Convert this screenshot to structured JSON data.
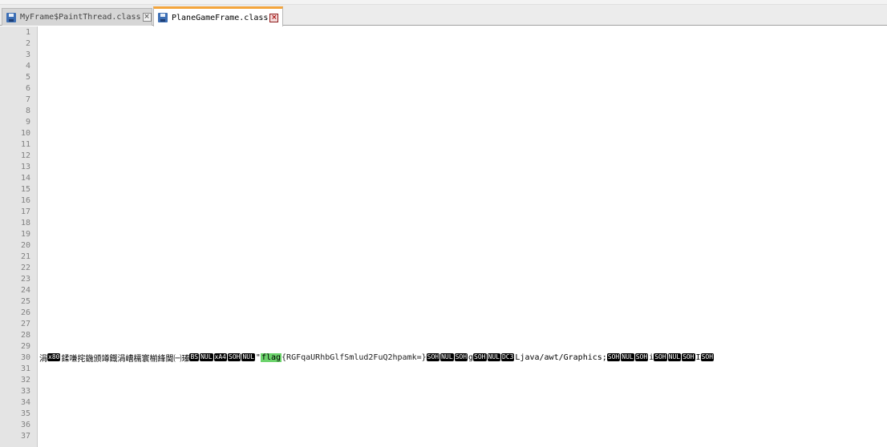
{
  "tabs": [
    {
      "label": "MyFrame$PaintThread.class",
      "active": false
    },
    {
      "label": "PlaneGameFrame.class",
      "active": true
    }
  ],
  "line_numbers": [
    "1",
    "2",
    "3",
    "4",
    "5",
    "6",
    "7",
    "8",
    "9",
    "10",
    "11",
    "12",
    "13",
    "14",
    "15",
    "16",
    "17",
    "18",
    "19",
    "20",
    "21",
    "22",
    "23",
    "24",
    "25",
    "26",
    "27",
    "28",
    "29",
    "30",
    "31",
    "32",
    "33",
    "34",
    "35",
    "36",
    "37"
  ],
  "line30": {
    "seg_1": "涓",
    "cc_1": "x80",
    "seg_2": "鍒嗛挓鍦颁竴鐡涓嶆檽寰椾綘閫㈠瑧",
    "cc_2": "BS",
    "cc_3": "NUL",
    "cc_4": "xA4",
    "cc_5": "SOH",
    "cc_6": "NUL",
    "seg_3": "\"",
    "flag_word": "flag",
    "flag_body": "{RGFqaURhbGlfSmlud2FuQ2hpamk=}",
    "cc_7": "SOH",
    "cc_8": "NUL",
    "cc_9": "SOH",
    "seg_4": "g",
    "cc_10": "SOH",
    "cc_11": "NUL",
    "cc_12": "DC3",
    "seg_5": "Ljava/awt/Graphics;",
    "cc_13": "SOH",
    "cc_14": "NUL",
    "cc_15": "SOH",
    "seg_6": "i",
    "cc_16": "SOH",
    "cc_17": "NUL",
    "cc_18": "SOH",
    "seg_7": "I",
    "cc_19": "SOH"
  },
  "colors": {
    "tab_accent": "#f4a53c",
    "flag_highlight": "#6bd36b",
    "control_char_bg": "#000000"
  }
}
